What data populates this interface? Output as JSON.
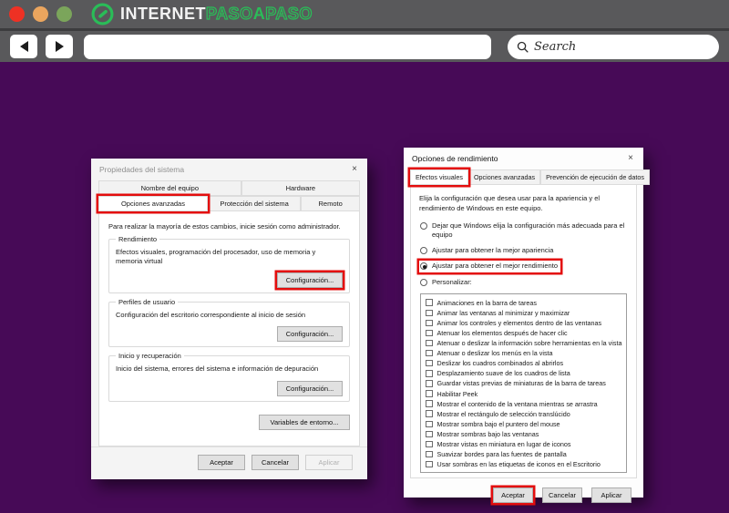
{
  "colors": {
    "accent_red": "#e30e0e",
    "background_purple": "#470a57",
    "chrome_gray": "#59595b",
    "logo_green": "#2abd58",
    "traffic_red": "#ee3124",
    "traffic_orange": "#eaa55e",
    "traffic_green": "#7ba55b"
  },
  "browser": {
    "logo": {
      "internet": "INTERNET",
      "paso1": "PASO",
      "a": "A",
      "paso2": "PASO"
    },
    "search_placeholder": "Search"
  },
  "left_dialog": {
    "title": "Propiedades del sistema",
    "close": "×",
    "tabs_row1": [
      {
        "label": "Nombre del equipo"
      },
      {
        "label": "Hardware"
      }
    ],
    "tabs_row2": [
      {
        "label": "Opciones avanzadas"
      },
      {
        "label": "Protección del sistema"
      },
      {
        "label": "Remoto"
      }
    ],
    "intro": "Para realizar la mayoría de estos cambios, inicie sesión como administrador.",
    "groups": [
      {
        "label": "Rendimiento",
        "text": "Efectos visuales, programación del procesador, uso de memoria y memoria virtual",
        "button": "Configuración..."
      },
      {
        "label": "Perfiles de usuario",
        "text": "Configuración del escritorio correspondiente al inicio de sesión",
        "button": "Configuración..."
      },
      {
        "label": "Inicio y recuperación",
        "text": "Inicio del sistema, errores del sistema e información de depuración",
        "button": "Configuración..."
      }
    ],
    "env_button": "Variables de entorno...",
    "footer": {
      "accept": "Aceptar",
      "cancel": "Cancelar",
      "apply": "Aplicar"
    }
  },
  "right_dialog": {
    "title": "Opciones de rendimiento",
    "close": "×",
    "tabs": [
      {
        "label": "Efectos visuales"
      },
      {
        "label": "Opciones avanzadas"
      },
      {
        "label": "Prevención de ejecución de datos"
      }
    ],
    "intro": "Elija la configuración que desea usar para la apariencia y el rendimiento de Windows en este equipo.",
    "radios": [
      {
        "label": "Dejar que Windows elija la configuración más adecuada para el equipo",
        "selected": false
      },
      {
        "label": "Ajustar para obtener la mejor apariencia",
        "selected": false
      },
      {
        "label": "Ajustar para obtener el mejor rendimiento",
        "selected": true
      },
      {
        "label": "Personalizar:",
        "selected": false
      }
    ],
    "checkboxes": [
      "Animaciones en la barra de tareas",
      "Animar las ventanas al minimizar y maximizar",
      "Animar los controles y elementos dentro de las ventanas",
      "Atenuar los elementos después de hacer clic",
      "Atenuar o deslizar la información sobre herramientas en la vista",
      "Atenuar o deslizar los menús en la vista",
      "Deslizar los cuadros combinados al abrirlos",
      "Desplazamiento suave de los cuadros de lista",
      "Guardar vistas previas de miniaturas de la barra de tareas",
      "Habilitar Peek",
      "Mostrar el contenido de la ventana mientras se arrastra",
      "Mostrar el rectángulo de selección translúcido",
      "Mostrar sombra bajo el puntero del mouse",
      "Mostrar sombras bajo las ventanas",
      "Mostrar vistas en miniatura en lugar de iconos",
      "Suavizar bordes para las fuentes de pantalla",
      "Usar sombras en las etiquetas de iconos en el Escritorio"
    ],
    "footer": {
      "accept": "Aceptar",
      "cancel": "Cancelar",
      "apply": "Aplicar"
    }
  }
}
